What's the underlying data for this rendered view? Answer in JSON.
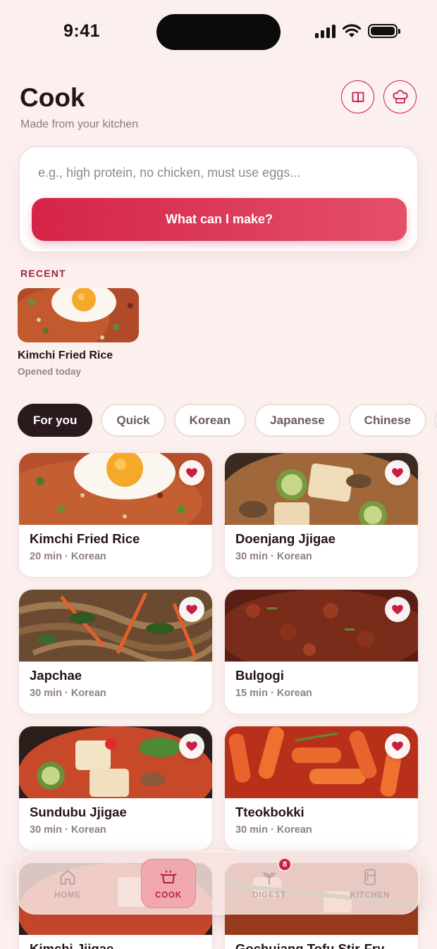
{
  "status_bar": {
    "time": "9:41"
  },
  "header": {
    "title": "Cook",
    "subtitle": "Made from your kitchen"
  },
  "search": {
    "placeholder": "e.g., high protein, no chicken, must use eggs...",
    "value": "",
    "button_label": "What can I make?"
  },
  "recent": {
    "label": "RECENT",
    "items": [
      {
        "title": "Kimchi Fried Rice",
        "subtitle": "Opened today"
      }
    ]
  },
  "chips": [
    {
      "label": "For you",
      "active": true
    },
    {
      "label": "Quick",
      "active": false
    },
    {
      "label": "Korean",
      "active": false
    },
    {
      "label": "Japanese",
      "active": false
    },
    {
      "label": "Chinese",
      "active": false
    },
    {
      "label": "",
      "active": false
    }
  ],
  "recipes": [
    {
      "title": "Kimchi Fried Rice",
      "meta": "20 min · Korean",
      "favorited": true
    },
    {
      "title": "Doenjang Jjigae",
      "meta": "30 min · Korean",
      "favorited": true
    },
    {
      "title": "Japchae",
      "meta": "30 min · Korean",
      "favorited": true
    },
    {
      "title": "Bulgogi",
      "meta": "15 min · Korean",
      "favorited": true
    },
    {
      "title": "Sundubu Jjigae",
      "meta": "30 min · Korean",
      "favorited": true
    },
    {
      "title": "Tteokbokki",
      "meta": "30 min · Korean",
      "favorited": true
    },
    {
      "title": "Kimchi Jjigae",
      "meta": "",
      "favorited": false
    },
    {
      "title": "Gochujang Tofu Stir-Fry",
      "meta": "",
      "favorited": false
    }
  ],
  "tab_bar": {
    "tabs": [
      {
        "label": "HOME",
        "icon": "home-icon",
        "active": false
      },
      {
        "label": "COOK",
        "icon": "pot-icon",
        "active": true
      },
      {
        "label": "DIGEST",
        "icon": "sprout-icon",
        "active": false,
        "badge": "8"
      },
      {
        "label": "KITCHEN",
        "icon": "fridge-icon",
        "active": false
      }
    ]
  },
  "colors": {
    "accent": "#c91f44",
    "background": "#fbf0ee",
    "chip_active": "#2b1a1d"
  }
}
